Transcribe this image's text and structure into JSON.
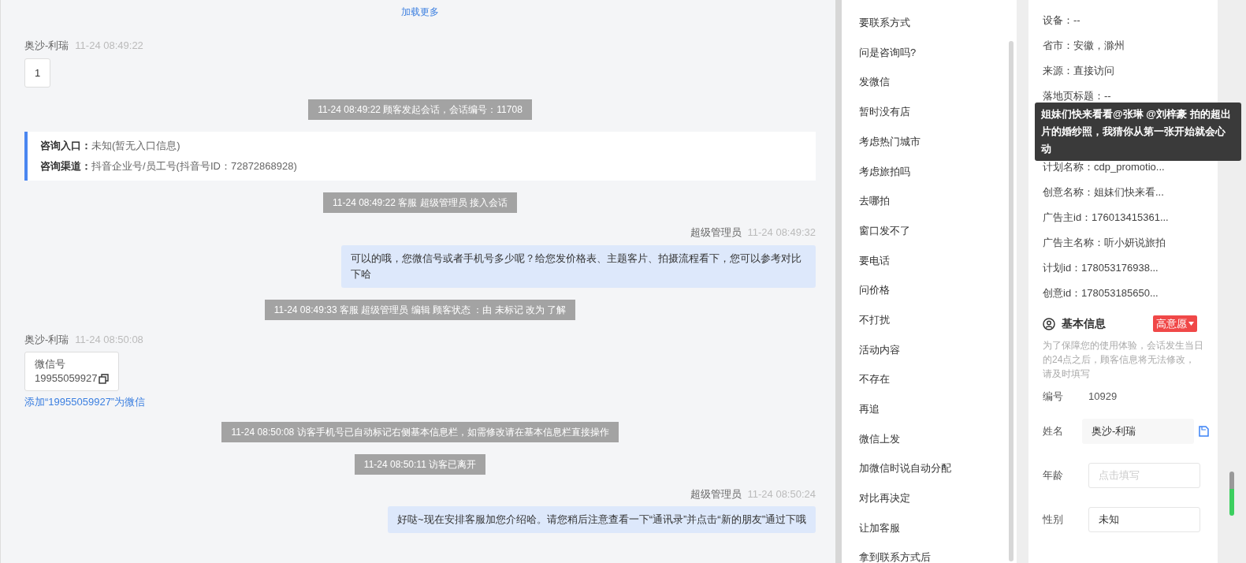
{
  "chat": {
    "load_more": "加载更多",
    "messages": [
      {
        "kind": "customer",
        "sender": "奥沙-利瑞",
        "time": "11-24 08:49:22",
        "card": {
          "kind": "text",
          "text": "1"
        }
      },
      {
        "kind": "system",
        "text": "11-24 08:49:22 顾客发起会话，会话编号：11708"
      },
      {
        "kind": "entry_info",
        "rows": [
          {
            "label": "咨询入口：",
            "value": "未知(暂无入口信息)"
          },
          {
            "label": "咨询渠道：",
            "value": "抖音企业号/员工号(抖音号ID：72872868928)"
          }
        ]
      },
      {
        "kind": "system",
        "text": "11-24 08:49:22 客服 超级管理员 接入会话"
      },
      {
        "kind": "agent",
        "sender": "超级管理员",
        "time": "11-24 08:49:32",
        "text": "可以的哦，您微信号或者手机号多少呢？给您发价格表、主题客片、拍摄流程看下，您可以参考对比下哈"
      },
      {
        "kind": "system",
        "text": "11-24 08:49:33 客服 超级管理员 编辑 顾客状态 ：由 未标记 改为 了解"
      },
      {
        "kind": "customer",
        "sender": "奥沙-利瑞",
        "time": "11-24 08:50:08",
        "card": {
          "kind": "wechat",
          "label": "微信号",
          "text": "19955059927"
        },
        "link": "添加“19955059927”为微信"
      },
      {
        "kind": "system",
        "text": "11-24 08:50:08 访客手机号已自动标记右侧基本信息栏，如需修改请在基本信息栏直接操作"
      },
      {
        "kind": "system",
        "text": "11-24 08:50:11 访客已离开"
      },
      {
        "kind": "agent",
        "sender": "超级管理员",
        "time": "11-24 08:50:24",
        "text": "好哒~现在安排客服加您介绍哈。请您稍后注意查看一下“通讯录”并点击“新的朋友”通过下哦"
      }
    ]
  },
  "quick_replies": [
    "要联系方式",
    "问是咨询吗?",
    "发微信",
    "暂时没有店",
    "考虑热门城市",
    "考虑旅拍吗",
    "去哪拍",
    "窗口发不了",
    "要电话",
    "问价格",
    "不打扰",
    "活动内容",
    "不存在",
    "再追",
    "微信上发",
    "加微信时说自动分配",
    "对比再决定",
    "让加客服",
    "拿到联系方式后"
  ],
  "customer_info": {
    "rows_top": [
      "设备：--",
      "省市：安徽，滁州",
      "来源：直接访问",
      "落地页标题：--"
    ],
    "tooltip": "姐妹们快来看看@张琳 @刘梓豪 拍的超出片的婚纱照，我猜你从第一张开始就会心动",
    "rows_bottom": [
      "计划名称：cdp_promotio...",
      "创意名称：姐妹们快来看...",
      "广告主id：176013415361...",
      "广告主名称：听小妍说旅拍",
      "计划id：178053176938...",
      "创意id：178053185650..."
    ],
    "section_title": "基本信息",
    "tag": "高意愿",
    "notice": "为了保障您的使用体验，会话发生当日的24点之后，顾客信息将无法修改，请及时填写",
    "fields": [
      {
        "kind": "static",
        "label": "编号",
        "value": "10929"
      },
      {
        "kind": "filled",
        "label": "姓名",
        "value": "奥沙-利瑞"
      },
      {
        "kind": "input",
        "label": "年龄",
        "placeholder": "点击填写"
      },
      {
        "kind": "input",
        "label": "性别",
        "value": "未知"
      }
    ]
  }
}
